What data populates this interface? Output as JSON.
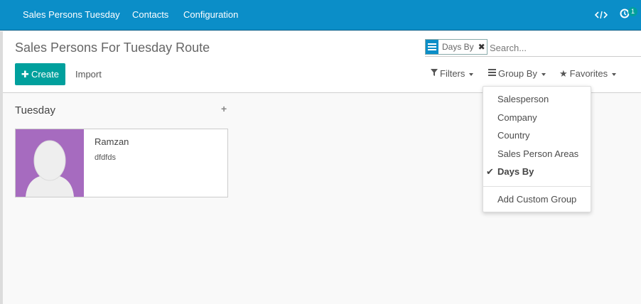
{
  "navbar": {
    "app_name": "Sales Persons Tuesday",
    "menu": [
      "Contacts",
      "Configuration"
    ],
    "activity_count": "1",
    "debug_icon": "code-icon",
    "activity_icon": "activity-clock-icon"
  },
  "control_panel": {
    "title": "Sales Persons For Tuesday Route",
    "create_label": "Create",
    "import_label": "Import"
  },
  "search": {
    "facet_label": "Days By",
    "placeholder": "Search...",
    "filters_label": "Filters",
    "groupby_label": "Group By",
    "favorites_label": "Favorites"
  },
  "groupby_dropdown": {
    "items": [
      {
        "label": "Salesperson",
        "checked": false
      },
      {
        "label": "Company",
        "checked": false
      },
      {
        "label": "Country",
        "checked": false
      },
      {
        "label": "Sales Person Areas",
        "checked": false
      },
      {
        "label": "Days By",
        "checked": true
      }
    ],
    "custom_label": "Add Custom Group"
  },
  "kanban": {
    "column_title": "Tuesday",
    "add_label": "+",
    "card": {
      "name": "Ramzan",
      "subtitle": "dfdfds"
    }
  },
  "colors": {
    "navbar": "#0b8ec8",
    "primary_button": "#00a09d",
    "avatar_bg": "#a66bbf"
  }
}
